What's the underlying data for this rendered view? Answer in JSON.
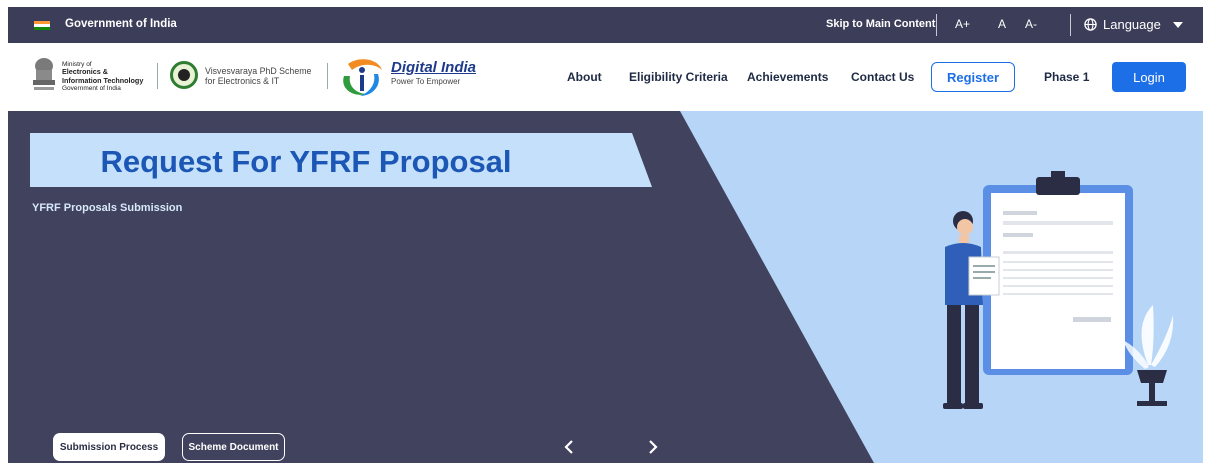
{
  "topbar": {
    "government_label": "Government of India",
    "skip_link": "Skip to Main Content",
    "font_increase": "A+",
    "font_normal": "A",
    "font_decrease": "A-",
    "language_label": "Language"
  },
  "header": {
    "ministry": {
      "line1": "Ministry of",
      "line2": "Electronics &",
      "line3": "Information Technology",
      "line4": "Government of India"
    },
    "scheme": {
      "line1": "Visvesvaraya PhD Scheme",
      "line2": "for Electronics & IT"
    },
    "digital_india": {
      "title": "Digital India",
      "tagline": "Power To Empower"
    },
    "nav": {
      "about": "About",
      "eligibility": "Eligibility Criteria",
      "achievements": "Achievements",
      "contact": "Contact Us",
      "register": "Register",
      "phase": "Phase 1",
      "login": "Login"
    }
  },
  "hero": {
    "title": "Request For YFRF Proposal",
    "subtitle": "YFRF Proposals Submission",
    "buttons": {
      "submission_process": "Submission Process",
      "scheme_document": "Scheme Document"
    }
  },
  "colors": {
    "topbar": "#3b3d59",
    "hero_dark": "#40425e",
    "hero_light": "#b7d6f7",
    "banner": "#c5e0fb",
    "title_blue": "#1c57b5",
    "primary_button": "#1d6fe8"
  }
}
